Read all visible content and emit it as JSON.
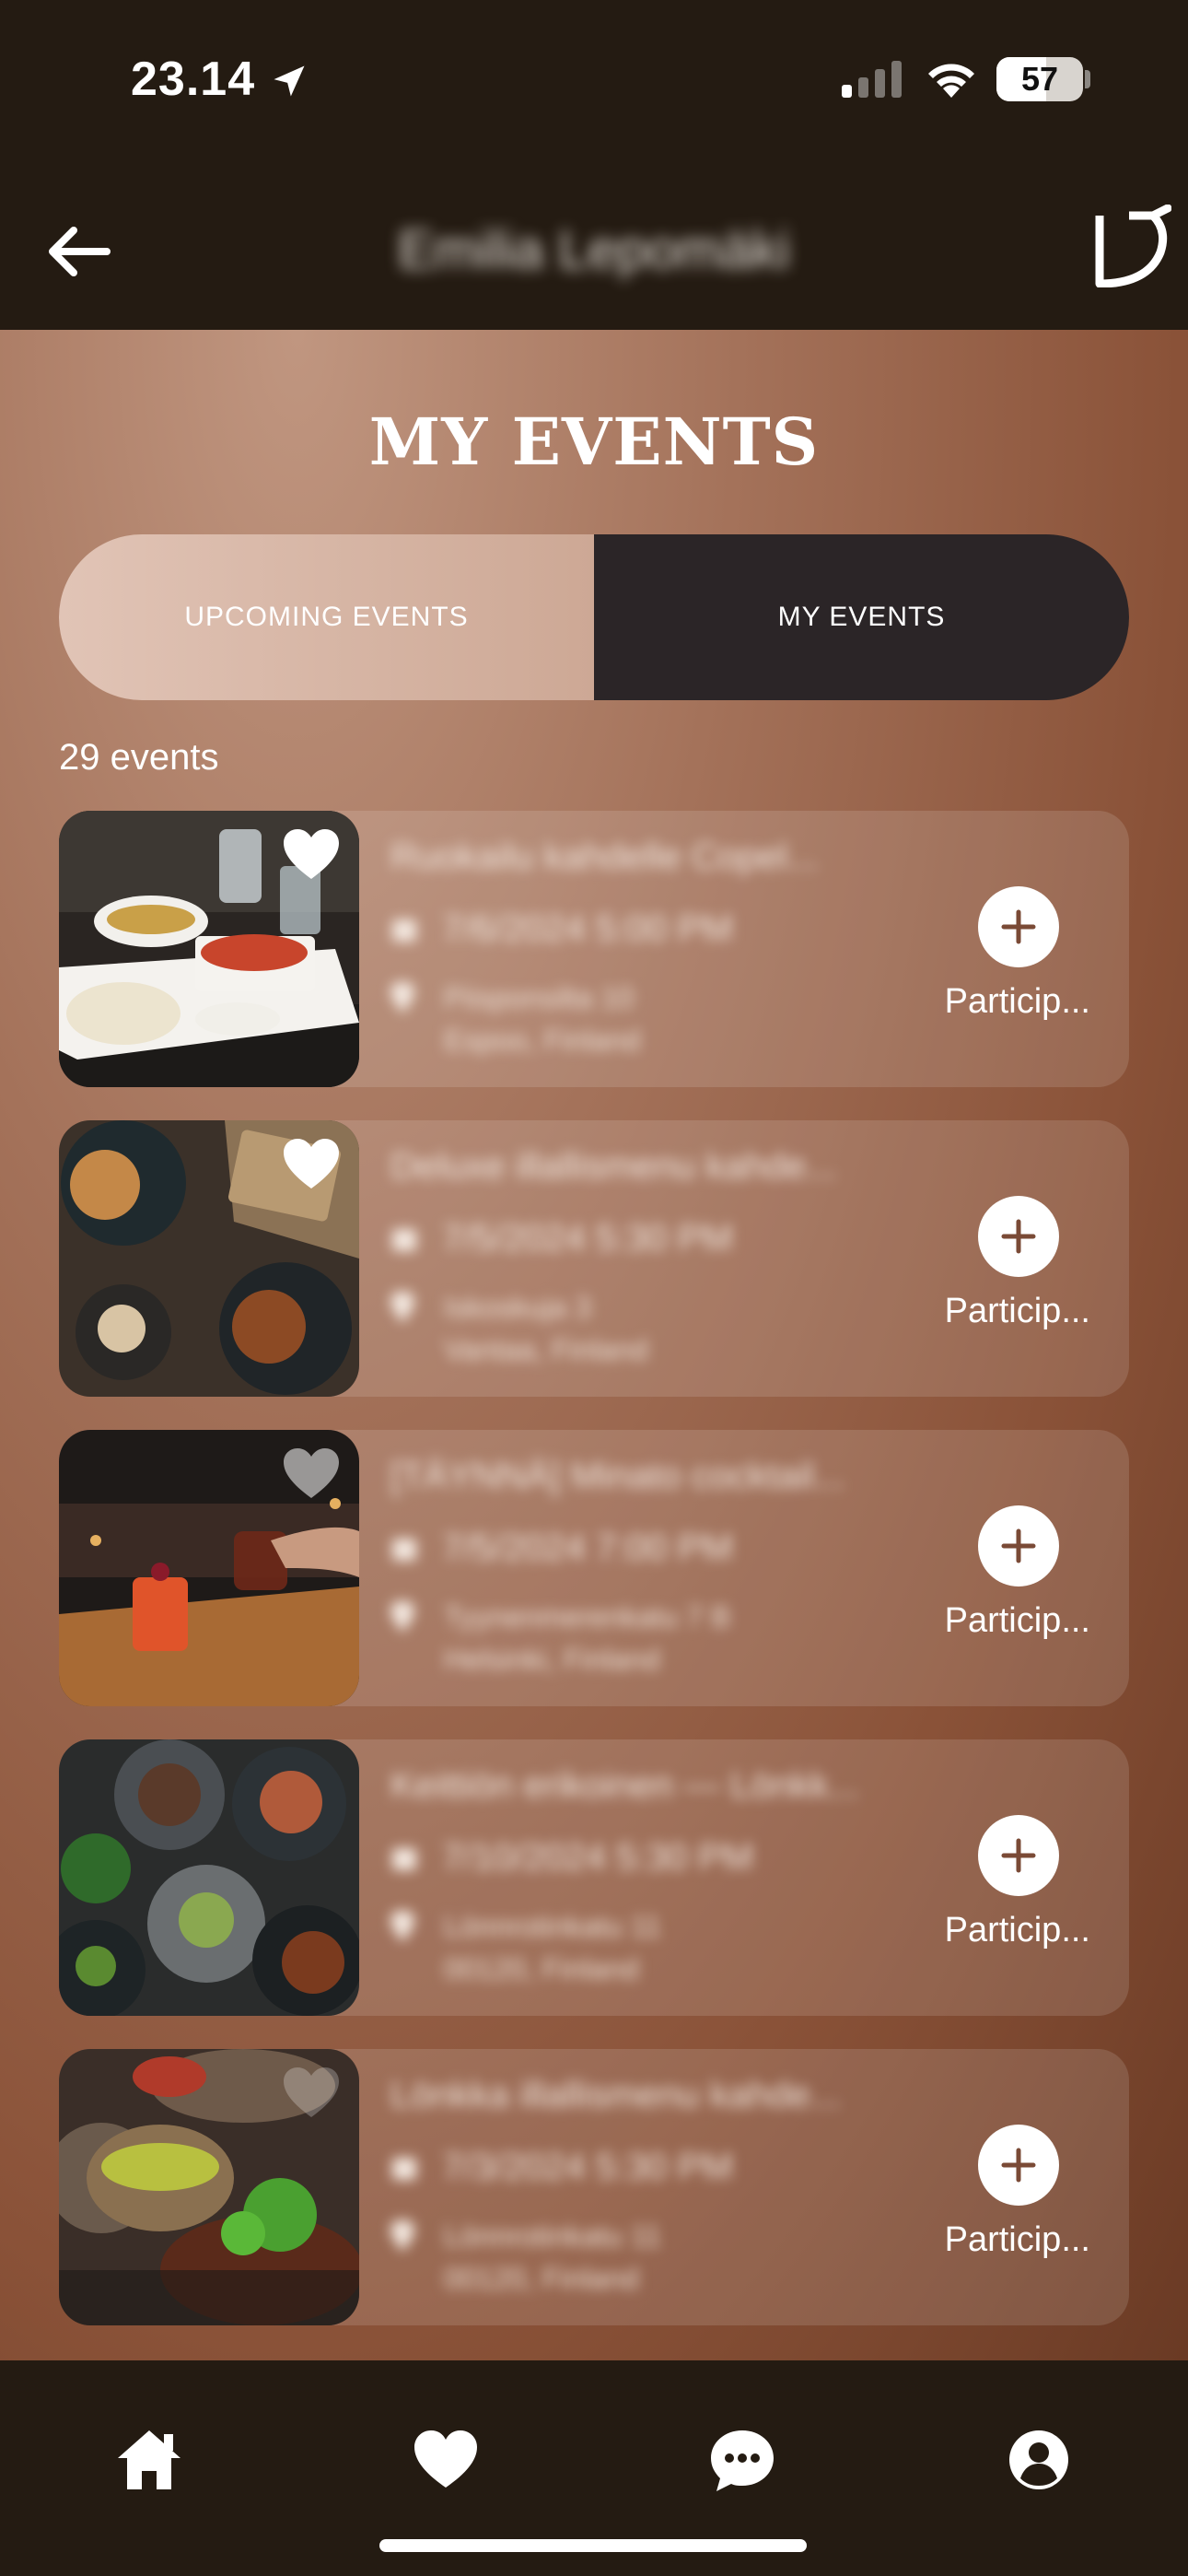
{
  "status_bar": {
    "time": "23.14",
    "battery": "57",
    "battery_level": 0.57
  },
  "header": {
    "title": "Emilia Lepomäki",
    "back_icon": "arrow-left-icon",
    "logo_icon": "brand-logo-icon"
  },
  "page": {
    "title": "MY EVENTS",
    "tabs": [
      {
        "label": "UPCOMING EVENTS",
        "selected": false
      },
      {
        "label": "MY EVENTS",
        "selected": true
      }
    ],
    "event_count": "29 events"
  },
  "events": [
    {
      "title": "Ruokailu kahdelle Copel...",
      "date": "7/6/2024 5:00 PM",
      "address_line1": "Piisponsilta 10",
      "address_line2": "Espoo, Finland",
      "favorite": true,
      "action_label": "Particip...",
      "image": "food-platter"
    },
    {
      "title": "Deluxe illallismenu kahde...",
      "date": "7/5/2024 5:30 PM",
      "address_line1": "Iskoskuja 3",
      "address_line2": "Vantaa, Finland",
      "favorite": true,
      "action_label": "Particip...",
      "image": "burgers"
    },
    {
      "title": "[TÄYNNÄ] Minato cocktail...",
      "date": "7/5/2024 7:00 PM",
      "address_line1": "Tyynenmerenkatu 7 B",
      "address_line2": "Helsinki, Finland",
      "favorite": false,
      "action_label": "Particip...",
      "image": "cocktails"
    },
    {
      "title": "Keittiön erikoinen — Lönkk...",
      "date": "7/10/2024 5:30 PM",
      "address_line1": "Lönnrotinkatu 11",
      "address_line2": "00120, Finland",
      "favorite": false,
      "action_label": "Particip...",
      "image": "dishes"
    },
    {
      "title": "Lönkka illallismenu kahde...",
      "date": "7/3/2024 5:30 PM",
      "address_line1": "Lönnrotinkatu 11",
      "address_line2": "00120, Finland",
      "favorite": false,
      "action_label": "Particip...",
      "image": "steak"
    }
  ],
  "bottom_nav": [
    {
      "icon": "home-icon"
    },
    {
      "icon": "heart-icon"
    },
    {
      "icon": "chat-icon"
    },
    {
      "icon": "profile-icon"
    }
  ],
  "colors": {
    "dark_bar": "#241b12",
    "selected_tab": "#2b2527",
    "unselected_tab": "#dcbcad"
  }
}
